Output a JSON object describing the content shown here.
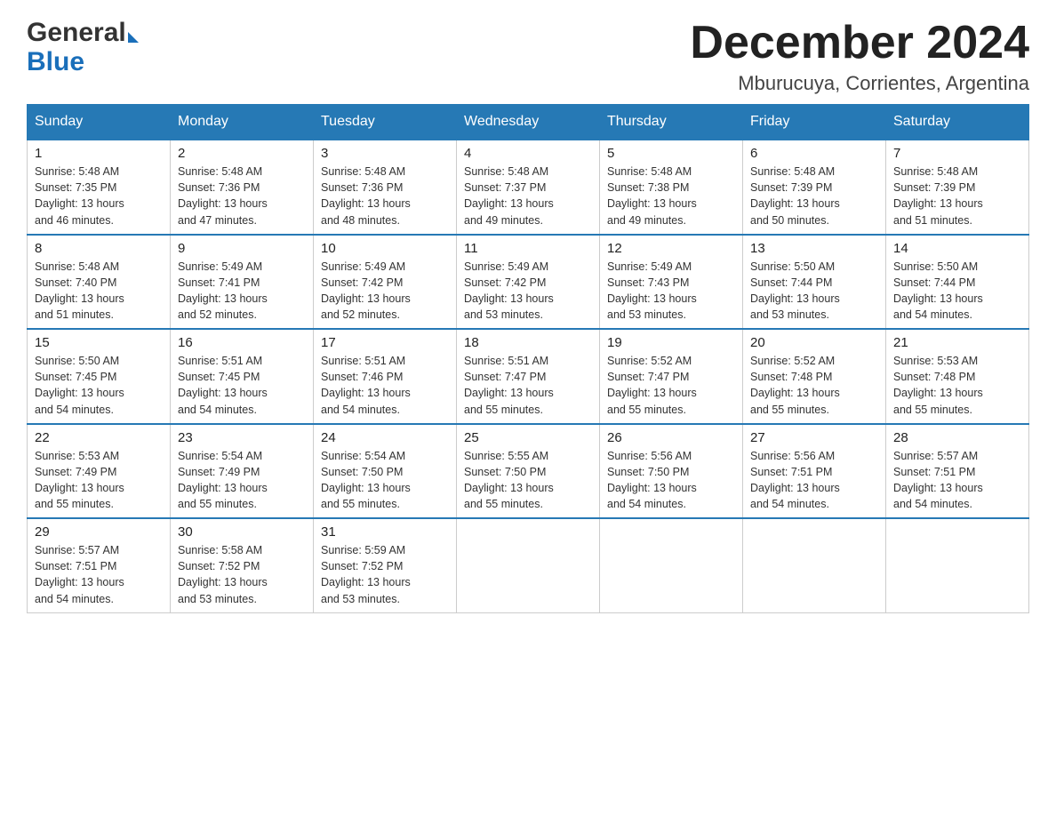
{
  "header": {
    "logo_general": "General",
    "logo_blue": "Blue",
    "main_title": "December 2024",
    "subtitle": "Mburucuya, Corrientes, Argentina"
  },
  "days_of_week": [
    "Sunday",
    "Monday",
    "Tuesday",
    "Wednesday",
    "Thursday",
    "Friday",
    "Saturday"
  ],
  "weeks": [
    [
      {
        "day": "1",
        "sunrise": "5:48 AM",
        "sunset": "7:35 PM",
        "daylight": "13 hours and 46 minutes."
      },
      {
        "day": "2",
        "sunrise": "5:48 AM",
        "sunset": "7:36 PM",
        "daylight": "13 hours and 47 minutes."
      },
      {
        "day": "3",
        "sunrise": "5:48 AM",
        "sunset": "7:36 PM",
        "daylight": "13 hours and 48 minutes."
      },
      {
        "day": "4",
        "sunrise": "5:48 AM",
        "sunset": "7:37 PM",
        "daylight": "13 hours and 49 minutes."
      },
      {
        "day": "5",
        "sunrise": "5:48 AM",
        "sunset": "7:38 PM",
        "daylight": "13 hours and 49 minutes."
      },
      {
        "day": "6",
        "sunrise": "5:48 AM",
        "sunset": "7:39 PM",
        "daylight": "13 hours and 50 minutes."
      },
      {
        "day": "7",
        "sunrise": "5:48 AM",
        "sunset": "7:39 PM",
        "daylight": "13 hours and 51 minutes."
      }
    ],
    [
      {
        "day": "8",
        "sunrise": "5:48 AM",
        "sunset": "7:40 PM",
        "daylight": "13 hours and 51 minutes."
      },
      {
        "day": "9",
        "sunrise": "5:49 AM",
        "sunset": "7:41 PM",
        "daylight": "13 hours and 52 minutes."
      },
      {
        "day": "10",
        "sunrise": "5:49 AM",
        "sunset": "7:42 PM",
        "daylight": "13 hours and 52 minutes."
      },
      {
        "day": "11",
        "sunrise": "5:49 AM",
        "sunset": "7:42 PM",
        "daylight": "13 hours and 53 minutes."
      },
      {
        "day": "12",
        "sunrise": "5:49 AM",
        "sunset": "7:43 PM",
        "daylight": "13 hours and 53 minutes."
      },
      {
        "day": "13",
        "sunrise": "5:50 AM",
        "sunset": "7:44 PM",
        "daylight": "13 hours and 53 minutes."
      },
      {
        "day": "14",
        "sunrise": "5:50 AM",
        "sunset": "7:44 PM",
        "daylight": "13 hours and 54 minutes."
      }
    ],
    [
      {
        "day": "15",
        "sunrise": "5:50 AM",
        "sunset": "7:45 PM",
        "daylight": "13 hours and 54 minutes."
      },
      {
        "day": "16",
        "sunrise": "5:51 AM",
        "sunset": "7:45 PM",
        "daylight": "13 hours and 54 minutes."
      },
      {
        "day": "17",
        "sunrise": "5:51 AM",
        "sunset": "7:46 PM",
        "daylight": "13 hours and 54 minutes."
      },
      {
        "day": "18",
        "sunrise": "5:51 AM",
        "sunset": "7:47 PM",
        "daylight": "13 hours and 55 minutes."
      },
      {
        "day": "19",
        "sunrise": "5:52 AM",
        "sunset": "7:47 PM",
        "daylight": "13 hours and 55 minutes."
      },
      {
        "day": "20",
        "sunrise": "5:52 AM",
        "sunset": "7:48 PM",
        "daylight": "13 hours and 55 minutes."
      },
      {
        "day": "21",
        "sunrise": "5:53 AM",
        "sunset": "7:48 PM",
        "daylight": "13 hours and 55 minutes."
      }
    ],
    [
      {
        "day": "22",
        "sunrise": "5:53 AM",
        "sunset": "7:49 PM",
        "daylight": "13 hours and 55 minutes."
      },
      {
        "day": "23",
        "sunrise": "5:54 AM",
        "sunset": "7:49 PM",
        "daylight": "13 hours and 55 minutes."
      },
      {
        "day": "24",
        "sunrise": "5:54 AM",
        "sunset": "7:50 PM",
        "daylight": "13 hours and 55 minutes."
      },
      {
        "day": "25",
        "sunrise": "5:55 AM",
        "sunset": "7:50 PM",
        "daylight": "13 hours and 55 minutes."
      },
      {
        "day": "26",
        "sunrise": "5:56 AM",
        "sunset": "7:50 PM",
        "daylight": "13 hours and 54 minutes."
      },
      {
        "day": "27",
        "sunrise": "5:56 AM",
        "sunset": "7:51 PM",
        "daylight": "13 hours and 54 minutes."
      },
      {
        "day": "28",
        "sunrise": "5:57 AM",
        "sunset": "7:51 PM",
        "daylight": "13 hours and 54 minutes."
      }
    ],
    [
      {
        "day": "29",
        "sunrise": "5:57 AM",
        "sunset": "7:51 PM",
        "daylight": "13 hours and 54 minutes."
      },
      {
        "day": "30",
        "sunrise": "5:58 AM",
        "sunset": "7:52 PM",
        "daylight": "13 hours and 53 minutes."
      },
      {
        "day": "31",
        "sunrise": "5:59 AM",
        "sunset": "7:52 PM",
        "daylight": "13 hours and 53 minutes."
      },
      null,
      null,
      null,
      null
    ]
  ],
  "labels": {
    "sunrise": "Sunrise: ",
    "sunset": "Sunset: ",
    "daylight": "Daylight: "
  }
}
